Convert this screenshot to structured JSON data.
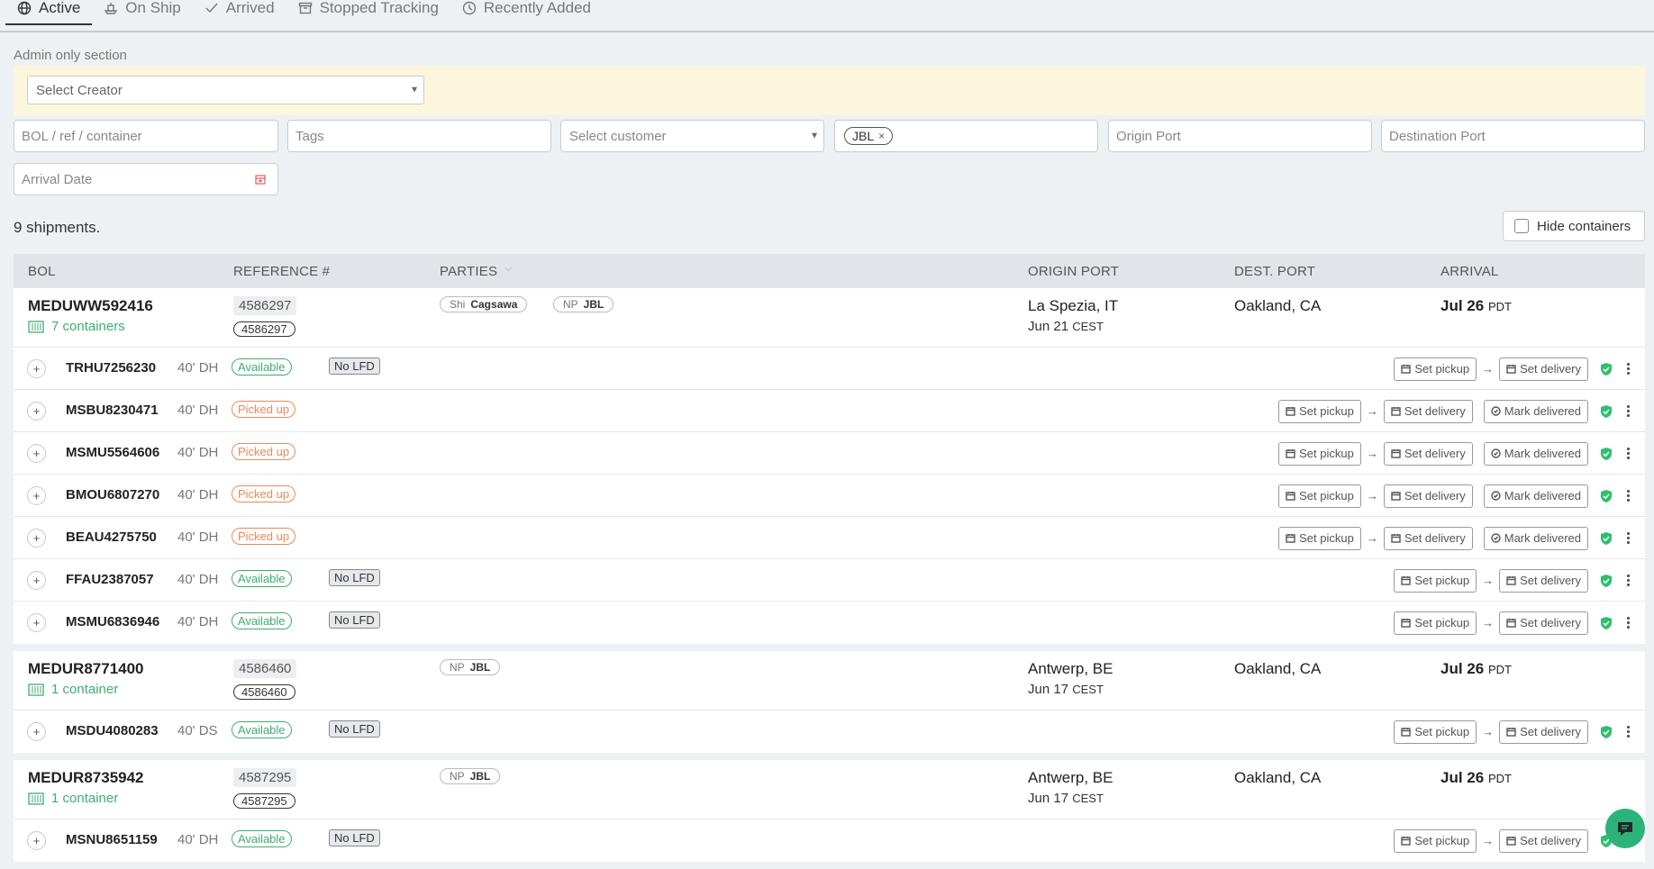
{
  "tabs": [
    {
      "label": "Active",
      "icon": "globe-icon"
    },
    {
      "label": "On Ship",
      "icon": "ship-icon"
    },
    {
      "label": "Arrived",
      "icon": "check-icon"
    },
    {
      "label": "Stopped Tracking",
      "icon": "archive-icon"
    },
    {
      "label": "Recently Added",
      "icon": "clock-icon"
    }
  ],
  "filters": {
    "admin_label": "Admin only section",
    "creator_select": "Select Creator",
    "bol_placeholder": "BOL / ref / container",
    "tags_placeholder": "Tags",
    "customer_select": "Select customer",
    "party_chip": "JBL",
    "origin_placeholder": "Origin Port",
    "destination_placeholder": "Destination Port",
    "arrival_placeholder": "Arrival Date"
  },
  "summary": {
    "count_text": "9 shipments.",
    "hide_containers": "Hide containers"
  },
  "columns": {
    "bol": "BOL",
    "reference": "REFERENCE #",
    "parties": "PARTIES",
    "origin": "ORIGIN PORT",
    "dest": "DEST. PORT",
    "arrival": "ARRIVAL"
  },
  "actions": {
    "set_pickup": "Set pickup",
    "set_delivery": "Set delivery",
    "mark_delivered": "Mark delivered",
    "arrow": "→"
  },
  "colors": {
    "green": "#3eae72",
    "orange": "#e88a5a",
    "admin_band": "#fcf6dc"
  },
  "shipments": [
    {
      "bol": "MEDUWW592416",
      "containers_label": "7 containers",
      "ref_top": "4586297",
      "ref_bottom": "4586297",
      "parties": [
        {
          "role": "Shi",
          "name": "Cagsawa"
        },
        {
          "role": "NP",
          "name": "JBL"
        }
      ],
      "origin": "La Spezia, IT",
      "origin_date": "Jun 21",
      "origin_tz": "CEST",
      "dest": "Oakland, CA",
      "arrival": "Jul 26",
      "arrival_tz": "PDT",
      "containers": [
        {
          "id": "TRHU7256230",
          "size": "40' DH",
          "status": "Available",
          "lfd": "No LFD"
        },
        {
          "id": "MSBU8230471",
          "size": "40' DH",
          "status": "Picked up",
          "lfd": ""
        },
        {
          "id": "MSMU5564606",
          "size": "40' DH",
          "status": "Picked up",
          "lfd": ""
        },
        {
          "id": "BMOU6807270",
          "size": "40' DH",
          "status": "Picked up",
          "lfd": ""
        },
        {
          "id": "BEAU4275750",
          "size": "40' DH",
          "status": "Picked up",
          "lfd": ""
        },
        {
          "id": "FFAU2387057",
          "size": "40' DH",
          "status": "Available",
          "lfd": "No LFD"
        },
        {
          "id": "MSMU6836946",
          "size": "40' DH",
          "status": "Available",
          "lfd": "No LFD"
        }
      ]
    },
    {
      "bol": "MEDUR8771400",
      "containers_label": "1 container",
      "ref_top": "4586460",
      "ref_bottom": "4586460",
      "parties": [
        {
          "role": "NP",
          "name": "JBL"
        }
      ],
      "origin": "Antwerp, BE",
      "origin_date": "Jun 17",
      "origin_tz": "CEST",
      "dest": "Oakland, CA",
      "arrival": "Jul 26",
      "arrival_tz": "PDT",
      "containers": [
        {
          "id": "MSDU4080283",
          "size": "40' DS",
          "status": "Available",
          "lfd": "No LFD"
        }
      ]
    },
    {
      "bol": "MEDUR8735942",
      "containers_label": "1 container",
      "ref_top": "4587295",
      "ref_bottom": "4587295",
      "parties": [
        {
          "role": "NP",
          "name": "JBL"
        }
      ],
      "origin": "Antwerp, BE",
      "origin_date": "Jun 17",
      "origin_tz": "CEST",
      "dest": "Oakland, CA",
      "arrival": "Jul 26",
      "arrival_tz": "PDT",
      "containers": [
        {
          "id": "MSNU8651159",
          "size": "40' DH",
          "status": "Available",
          "lfd": "No LFD"
        }
      ]
    }
  ]
}
